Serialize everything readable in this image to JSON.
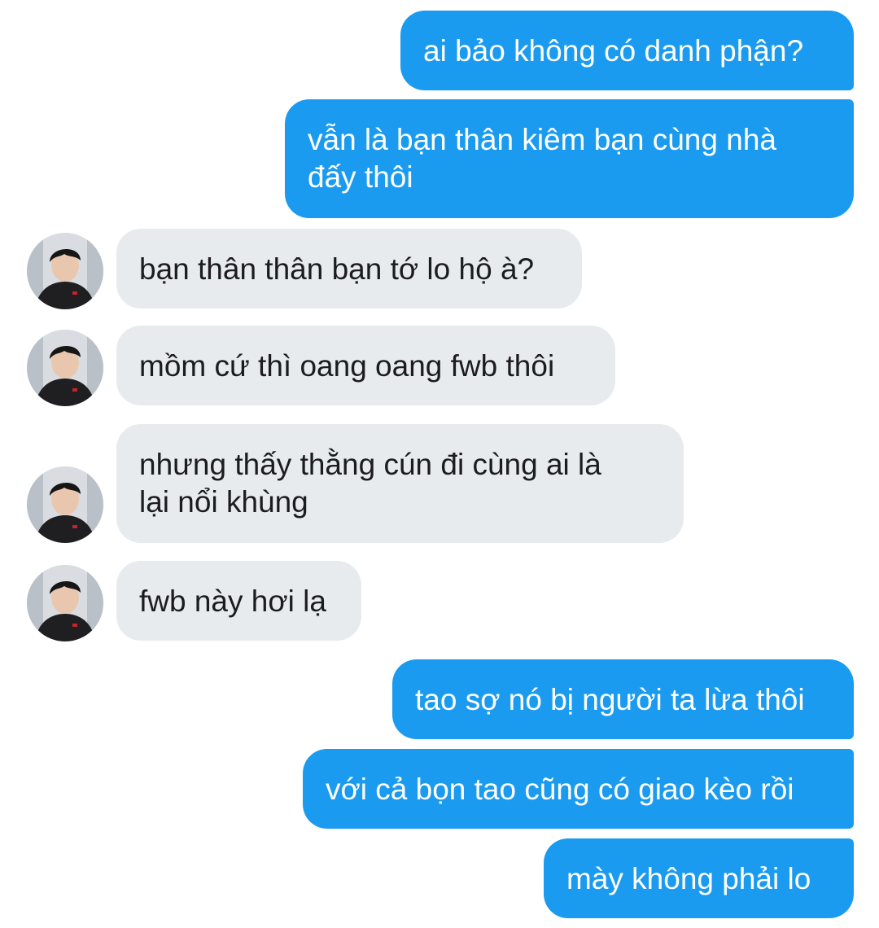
{
  "conversation": {
    "messages": [
      {
        "sender": "me",
        "text": "ai bảo không có danh phận?"
      },
      {
        "sender": "me",
        "text": "vẫn là bạn thân kiêm bạn cùng nhà đấy thôi",
        "line1": "vẫn là bạn thân kiêm bạn cùng nhà",
        "line2": "đấy thôi"
      },
      {
        "sender": "contact",
        "text": "bạn thân thân bạn tớ lo hộ à?"
      },
      {
        "sender": "contact",
        "text": "mồm cứ thì oang oang fwb thôi"
      },
      {
        "sender": "contact",
        "text": "nhưng thấy thằng cún đi cùng ai là lại nổi khùng",
        "line1": "nhưng thấy thằng cún đi cùng ai là",
        "line2": "lại nổi khùng"
      },
      {
        "sender": "contact",
        "text": "fwb này hơi lạ"
      },
      {
        "sender": "me",
        "text": "tao sợ nó bị người ta lừa thôi"
      },
      {
        "sender": "me",
        "text": "với cả bọn tao cũng có giao kèo rồi"
      },
      {
        "sender": "me",
        "text": "mày không phải lo"
      }
    ]
  },
  "colors": {
    "outgoing_bubble": "#1a9bf0",
    "incoming_bubble": "#e8ebee",
    "outgoing_text": "#ffffff",
    "incoming_text": "#1c1c1e"
  },
  "contact_avatar_icon": "user-avatar-photo"
}
